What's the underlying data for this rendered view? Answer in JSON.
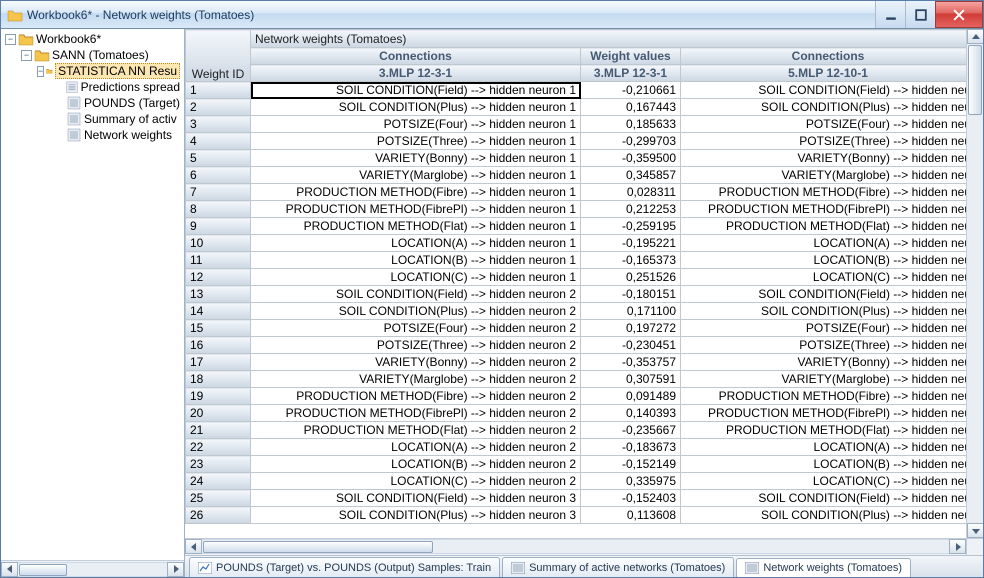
{
  "window": {
    "title": "Workbook6* - Network weights (Tomatoes)",
    "icons": {
      "app": "folder",
      "minimize": "min",
      "maximize": "max",
      "close": "x"
    }
  },
  "tree": {
    "items": [
      {
        "indent": 0,
        "expander": "-",
        "icon": "folder-open",
        "label": "Workbook6*"
      },
      {
        "indent": 1,
        "expander": "-",
        "icon": "folder-open",
        "label": "SANN (Tomatoes)"
      },
      {
        "indent": 2,
        "expander": "-",
        "icon": "folder-sel",
        "label": "STATISTICA NN Resu",
        "selected": true
      },
      {
        "indent": 3,
        "expander": " ",
        "icon": "sheet",
        "label": "Predictions spread"
      },
      {
        "indent": 3,
        "expander": " ",
        "icon": "sheet",
        "label": "POUNDS (Target)"
      },
      {
        "indent": 3,
        "expander": " ",
        "icon": "sheet",
        "label": "Summary of activ"
      },
      {
        "indent": 3,
        "expander": " ",
        "icon": "sheet",
        "label": "Network weights"
      }
    ]
  },
  "grid": {
    "supertitle": "Network weights (Tomatoes)",
    "rowhdr_label": "Weight ID",
    "cols": [
      {
        "line1": "Connections",
        "line2": "3.MLP 12-3-1"
      },
      {
        "line1": "Weight values",
        "line2": "3.MLP 12-3-1"
      },
      {
        "line1": "Connections",
        "line2": "5.MLP 12-10-1"
      }
    ],
    "rows": [
      {
        "id": "1",
        "c1": "SOIL CONDITION(Field) --> hidden neuron 1",
        "v": "-0,210661",
        "c2": "SOIL CONDITION(Field) --> hidden neu",
        "sel": true
      },
      {
        "id": "2",
        "c1": "SOIL CONDITION(Plus) --> hidden neuron 1",
        "v": "0,167443",
        "c2": "SOIL CONDITION(Plus) --> hidden neu"
      },
      {
        "id": "3",
        "c1": "POTSIZE(Four) --> hidden neuron 1",
        "v": "0,185633",
        "c2": "POTSIZE(Four) --> hidden neu"
      },
      {
        "id": "4",
        "c1": "POTSIZE(Three) --> hidden neuron 1",
        "v": "-0,299703",
        "c2": "POTSIZE(Three) --> hidden neu"
      },
      {
        "id": "5",
        "c1": "VARIETY(Bonny) --> hidden neuron 1",
        "v": "-0,359500",
        "c2": "VARIETY(Bonny) --> hidden neu"
      },
      {
        "id": "6",
        "c1": "VARIETY(Marglobe) --> hidden neuron 1",
        "v": "0,345857",
        "c2": "VARIETY(Marglobe) --> hidden neu"
      },
      {
        "id": "7",
        "c1": "PRODUCTION METHOD(Fibre) --> hidden neuron 1",
        "v": "0,028311",
        "c2": "PRODUCTION METHOD(Fibre) --> hidden neu"
      },
      {
        "id": "8",
        "c1": "PRODUCTION METHOD(FibrePl) --> hidden neuron 1",
        "v": "0,212253",
        "c2": "PRODUCTION METHOD(FibrePl) --> hidden neu"
      },
      {
        "id": "9",
        "c1": "PRODUCTION METHOD(Flat) --> hidden neuron 1",
        "v": "-0,259195",
        "c2": "PRODUCTION METHOD(Flat) --> hidden neu"
      },
      {
        "id": "10",
        "c1": "LOCATION(A) --> hidden neuron 1",
        "v": "-0,195221",
        "c2": "LOCATION(A) --> hidden neu"
      },
      {
        "id": "11",
        "c1": "LOCATION(B) --> hidden neuron 1",
        "v": "-0,165373",
        "c2": "LOCATION(B) --> hidden neu"
      },
      {
        "id": "12",
        "c1": "LOCATION(C) --> hidden neuron 1",
        "v": "0,251526",
        "c2": "LOCATION(C) --> hidden neu"
      },
      {
        "id": "13",
        "c1": "SOIL CONDITION(Field) --> hidden neuron 2",
        "v": "-0,180151",
        "c2": "SOIL CONDITION(Field) --> hidden neu"
      },
      {
        "id": "14",
        "c1": "SOIL CONDITION(Plus) --> hidden neuron 2",
        "v": "0,171100",
        "c2": "SOIL CONDITION(Plus) --> hidden neu"
      },
      {
        "id": "15",
        "c1": "POTSIZE(Four) --> hidden neuron 2",
        "v": "0,197272",
        "c2": "POTSIZE(Four) --> hidden neu"
      },
      {
        "id": "16",
        "c1": "POTSIZE(Three) --> hidden neuron 2",
        "v": "-0,230451",
        "c2": "POTSIZE(Three) --> hidden neu"
      },
      {
        "id": "17",
        "c1": "VARIETY(Bonny) --> hidden neuron 2",
        "v": "-0,353757",
        "c2": "VARIETY(Bonny) --> hidden neu"
      },
      {
        "id": "18",
        "c1": "VARIETY(Marglobe) --> hidden neuron 2",
        "v": "0,307591",
        "c2": "VARIETY(Marglobe) --> hidden neu"
      },
      {
        "id": "19",
        "c1": "PRODUCTION METHOD(Fibre) --> hidden neuron 2",
        "v": "0,091489",
        "c2": "PRODUCTION METHOD(Fibre) --> hidden neu"
      },
      {
        "id": "20",
        "c1": "PRODUCTION METHOD(FibrePl) --> hidden neuron 2",
        "v": "0,140393",
        "c2": "PRODUCTION METHOD(FibrePl) --> hidden neu"
      },
      {
        "id": "21",
        "c1": "PRODUCTION METHOD(Flat) --> hidden neuron 2",
        "v": "-0,235667",
        "c2": "PRODUCTION METHOD(Flat) --> hidden neu"
      },
      {
        "id": "22",
        "c1": "LOCATION(A) --> hidden neuron 2",
        "v": "-0,183673",
        "c2": "LOCATION(A) --> hidden neu"
      },
      {
        "id": "23",
        "c1": "LOCATION(B) --> hidden neuron 2",
        "v": "-0,152149",
        "c2": "LOCATION(B) --> hidden neu"
      },
      {
        "id": "24",
        "c1": "LOCATION(C) --> hidden neuron 2",
        "v": "0,335975",
        "c2": "LOCATION(C) --> hidden neu"
      },
      {
        "id": "25",
        "c1": "SOIL CONDITION(Field) --> hidden neuron 3",
        "v": "-0,152403",
        "c2": "SOIL CONDITION(Field) --> hidden neu"
      },
      {
        "id": "26",
        "c1": "SOIL CONDITION(Plus) --> hidden neuron 3",
        "v": "0,113608",
        "c2": "SOIL CONDITION(Plus) --> hidden neu"
      }
    ]
  },
  "tabs": [
    {
      "label": "POUNDS (Target) vs. POUNDS (Output)  Samples: Train",
      "icon": "chart"
    },
    {
      "label": "Summary of active networks (Tomatoes)",
      "icon": "sheet"
    },
    {
      "label": "Network weights (Tomatoes)",
      "icon": "sheet",
      "active": true
    }
  ]
}
